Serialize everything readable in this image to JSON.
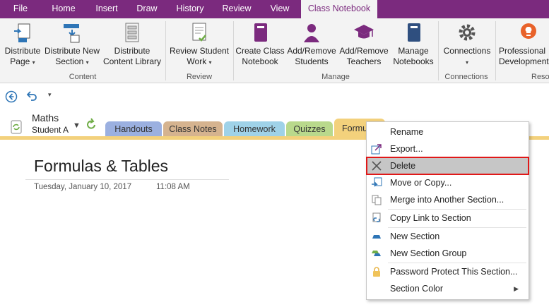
{
  "menu_tabs": [
    "File",
    "Home",
    "Insert",
    "Draw",
    "History",
    "Review",
    "View",
    "Class Notebook"
  ],
  "ribbon": {
    "groups": {
      "content": "Content",
      "review": "Review",
      "manage": "Manage",
      "connections": "Connections",
      "resources": "Reso"
    },
    "buttons": {
      "distribute_page": [
        "Distribute",
        "Page"
      ],
      "distribute_section": [
        "Distribute New",
        "Section"
      ],
      "distribute_library": [
        "Distribute",
        "Content Library"
      ],
      "review_student": [
        "Review Student",
        "Work"
      ],
      "create_notebook": [
        "Create Class",
        "Notebook"
      ],
      "add_students": [
        "Add/Remove",
        "Students"
      ],
      "add_teachers": [
        "Add/Remove",
        "Teachers"
      ],
      "manage_notebooks": [
        "Manage",
        "Notebooks"
      ],
      "connections": [
        "Connections"
      ],
      "professional": [
        "Professional",
        "Development"
      ]
    }
  },
  "notebook": {
    "name": "Maths",
    "user": "Student A"
  },
  "section_tabs": [
    "Handouts",
    "Class Notes",
    "Homework",
    "Quizzes",
    "Formu"
  ],
  "page": {
    "title": "Formulas & Tables",
    "date": "Tuesday, January 10, 2017",
    "time": "11:08 AM"
  },
  "context_menu": {
    "items": [
      "Rename",
      "Export...",
      "Delete",
      "Move or Copy...",
      "Merge into Another Section...",
      "Copy Link to Section",
      "New Section",
      "New Section Group",
      "Password Protect This Section...",
      "Section Color"
    ],
    "highlighted": "Delete"
  },
  "colors": {
    "accent": "#7b2a7e",
    "highlight_border": "#e01818",
    "tab_handouts": "#9bb0e0",
    "tab_classnotes": "#d5b38f",
    "tab_homework": "#9fd2e8",
    "tab_quizzes": "#b9d98c",
    "tab_formulas": "#f3d17c"
  }
}
